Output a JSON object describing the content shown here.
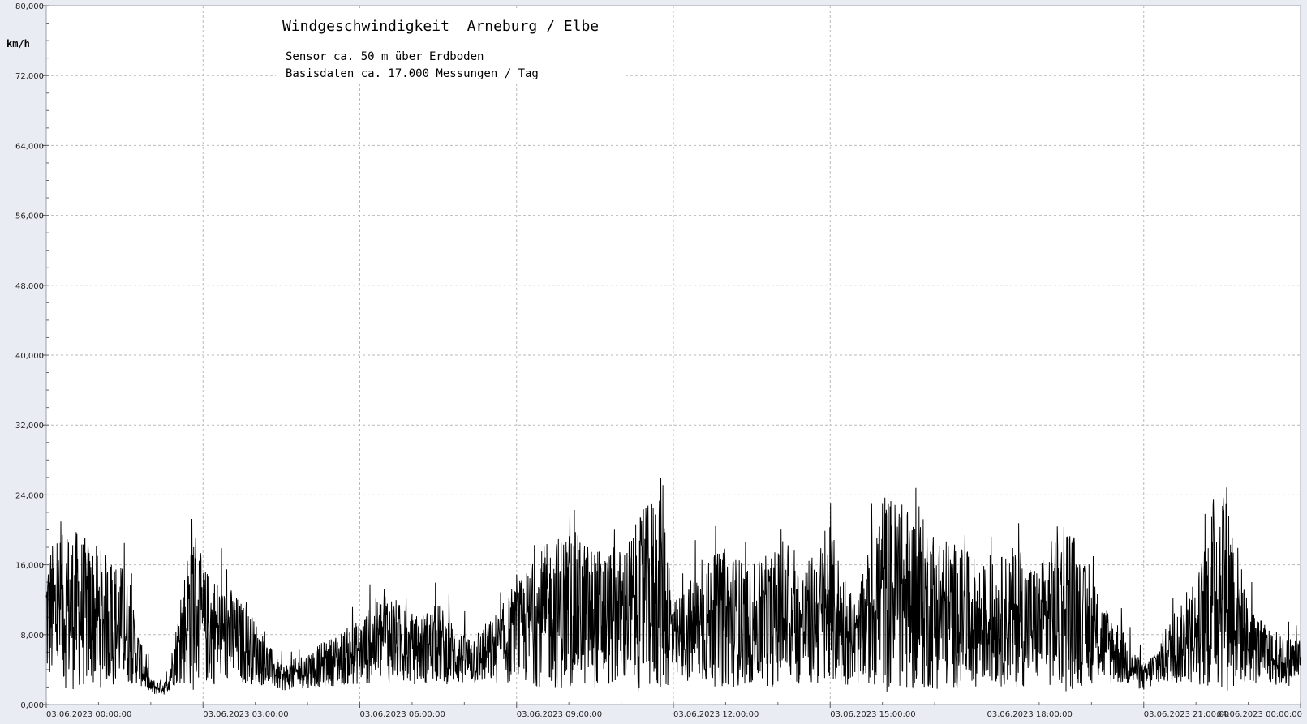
{
  "chart_data": {
    "type": "line",
    "title": "Windgeschwindigkeit  Arneburg / Elbe",
    "subtitles": [
      "Sensor ca. 50 m über Erdboden",
      "Basisdaten ca. 17.000 Messungen / Tag"
    ],
    "ylabel": "km/h",
    "xlabel": "",
    "ylim": [
      0,
      80
    ],
    "xlim_hours": [
      0,
      24
    ],
    "grid": true,
    "y_ticks": [
      "0,000",
      "8,000",
      "16,000",
      "24,000",
      "32,000",
      "40,000",
      "48,000",
      "56,000",
      "64,000",
      "72,000",
      "80,000"
    ],
    "x_tick_labels": [
      "03.06.2023  00:00:00",
      "03.06.2023  03:00:00",
      "03.06.2023  06:00:00",
      "03.06.2023  09:00:00",
      "03.06.2023  12:00:00",
      "03.06.2023  15:00:00",
      "03.06.2023  18:00:00",
      "03.06.2023  21:00:00",
      "04.06.2023  00:00:00"
    ],
    "series": [
      {
        "color": "#000000",
        "x_hours": [
          0,
          0.5,
          1,
          1.5,
          2,
          2.3,
          2.6,
          2.8,
          3,
          3.5,
          4,
          4.5,
          5,
          5.5,
          6,
          6.5,
          7,
          7.5,
          8,
          8.5,
          9,
          9.5,
          10,
          10.5,
          11,
          11.5,
          11.8,
          12,
          12.5,
          13,
          13.5,
          14,
          14.5,
          15,
          15.5,
          16,
          16.5,
          17,
          17.5,
          18,
          18.5,
          19,
          19.5,
          20,
          20.5,
          21,
          21.5,
          22,
          22.5,
          23,
          23.5,
          24
        ],
        "y": [
          10,
          11,
          10,
          9,
          2,
          2,
          8,
          12,
          9,
          8,
          6,
          3,
          4,
          5,
          6,
          8,
          6,
          7,
          5,
          6,
          8,
          10,
          11,
          10,
          10,
          12,
          14,
          7,
          9,
          10,
          9,
          10,
          9,
          11,
          7,
          13,
          12,
          11,
          10,
          9,
          10,
          9,
          12,
          8,
          6,
          3,
          6,
          8,
          15,
          7,
          5,
          5
        ]
      }
    ]
  }
}
